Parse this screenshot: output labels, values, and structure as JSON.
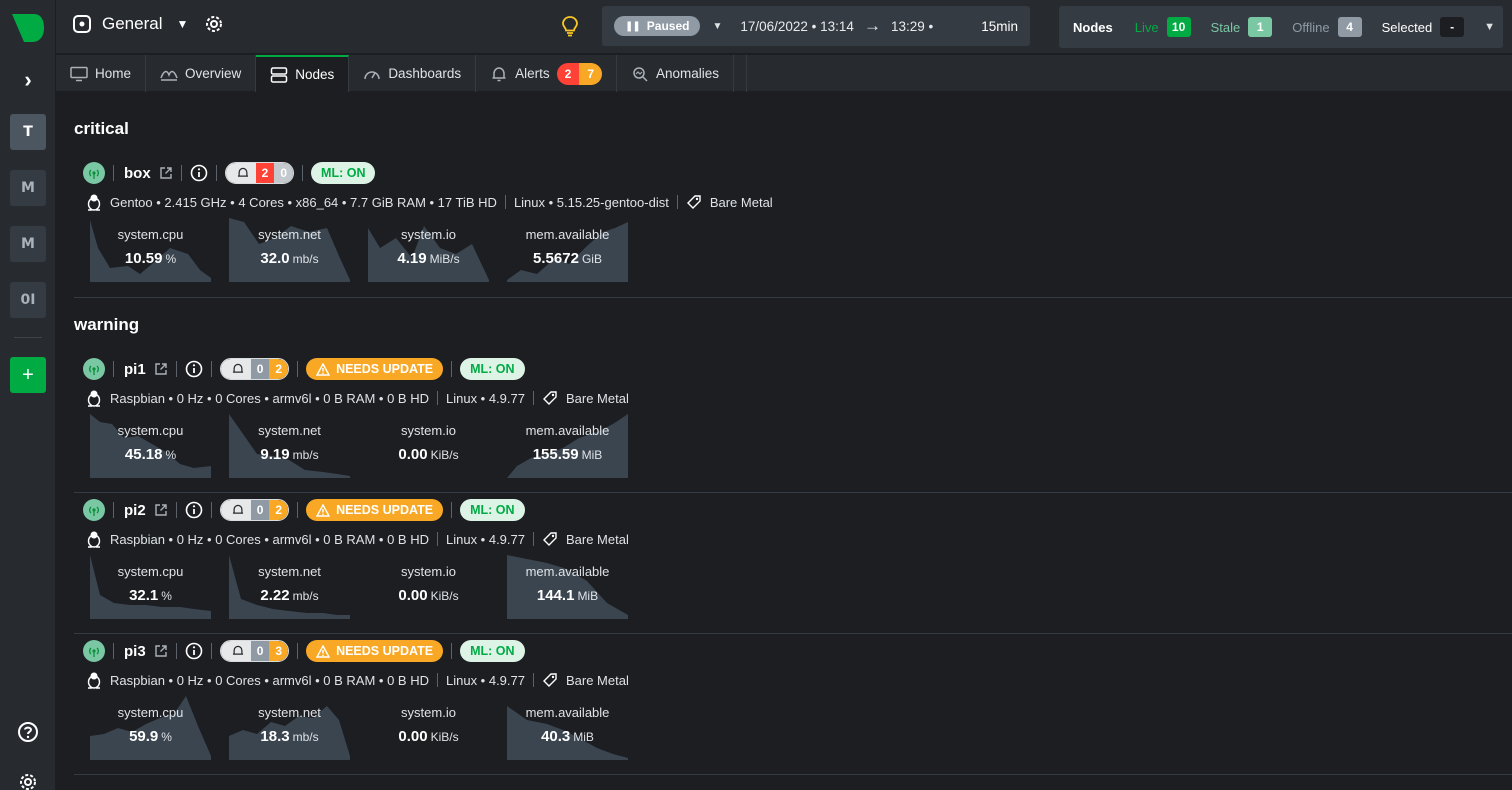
{
  "header": {
    "room_name": "General",
    "playback_status": "Paused",
    "date_start": "17/06/2022 • 13:14",
    "arrow": "→",
    "time_end": "13:29 •",
    "duration": "15min",
    "nodes_label": "Nodes",
    "live_label": "Live",
    "live_count": "10",
    "stale_label": "Stale",
    "stale_count": "1",
    "offline_label": "Offline",
    "offline_count": "4",
    "selected_label": "Selected",
    "selected_count": "-"
  },
  "rail": {
    "spaces": [
      "T",
      "M",
      "M",
      "0I"
    ],
    "add_label": "+"
  },
  "tabs": [
    {
      "label": "Home"
    },
    {
      "label": "Overview"
    },
    {
      "label": "Nodes"
    },
    {
      "label": "Dashboards"
    },
    {
      "label": "Alerts",
      "critical": "2",
      "warning": "7"
    },
    {
      "label": "Anomalies"
    }
  ],
  "groups": {
    "critical": "critical",
    "warning": "warning"
  },
  "nodes": [
    {
      "name": "box",
      "alerts_critical": "2",
      "alerts_warning": "0",
      "ml": "ML: ON",
      "badge": "",
      "os": "Gentoo • 2.415 GHz • 4 Cores • x86_64 • 7.7 GiB RAM • 17 TiB HD",
      "kernel": "Linux • 5.15.25-gentoo-dist",
      "platform": "Bare Metal",
      "charts": [
        {
          "name": "system.cpu",
          "value": "10.59",
          "unit": "%"
        },
        {
          "name": "system.net",
          "value": "32.0",
          "unit": "mb/s"
        },
        {
          "name": "system.io",
          "value": "4.19",
          "unit": "MiB/s"
        },
        {
          "name": "mem.available",
          "value": "5.5672",
          "unit": "GiB"
        }
      ]
    },
    {
      "name": "pi1",
      "alerts_critical": "0",
      "alerts_warning": "2",
      "ml": "ML: ON",
      "badge": "NEEDS UPDATE",
      "os": "Raspbian • 0 Hz • 0 Cores • armv6l • 0 B RAM • 0 B HD",
      "kernel": "Linux • 4.9.77",
      "platform": "Bare Metal",
      "charts": [
        {
          "name": "system.cpu",
          "value": "45.18",
          "unit": "%"
        },
        {
          "name": "system.net",
          "value": "9.19",
          "unit": "mb/s"
        },
        {
          "name": "system.io",
          "value": "0.00",
          "unit": "KiB/s"
        },
        {
          "name": "mem.available",
          "value": "155.59",
          "unit": "MiB"
        }
      ]
    },
    {
      "name": "pi2",
      "alerts_critical": "0",
      "alerts_warning": "2",
      "ml": "ML: ON",
      "badge": "NEEDS UPDATE",
      "os": "Raspbian • 0 Hz • 0 Cores • armv6l • 0 B RAM • 0 B HD",
      "kernel": "Linux • 4.9.77",
      "platform": "Bare Metal",
      "charts": [
        {
          "name": "system.cpu",
          "value": "32.1",
          "unit": "%"
        },
        {
          "name": "system.net",
          "value": "2.22",
          "unit": "mb/s"
        },
        {
          "name": "system.io",
          "value": "0.00",
          "unit": "KiB/s"
        },
        {
          "name": "mem.available",
          "value": "144.1",
          "unit": "MiB"
        }
      ]
    },
    {
      "name": "pi3",
      "alerts_critical": "0",
      "alerts_warning": "3",
      "ml": "ML: ON",
      "badge": "NEEDS UPDATE",
      "os": "Raspbian • 0 Hz • 0 Cores • armv6l • 0 B RAM • 0 B HD",
      "kernel": "Linux • 4.9.77",
      "platform": "Bare Metal",
      "charts": [
        {
          "name": "system.cpu",
          "value": "59.9",
          "unit": "%"
        },
        {
          "name": "system.net",
          "value": "18.3",
          "unit": "mb/s"
        },
        {
          "name": "system.io",
          "value": "0.00",
          "unit": "KiB/s"
        },
        {
          "name": "mem.available",
          "value": "40.3",
          "unit": "MiB"
        }
      ]
    }
  ],
  "colors": {
    "brand": "#00ab44",
    "critical": "#ff4136",
    "warning": "#f9a825",
    "chart_fill": "#3b4550"
  }
}
